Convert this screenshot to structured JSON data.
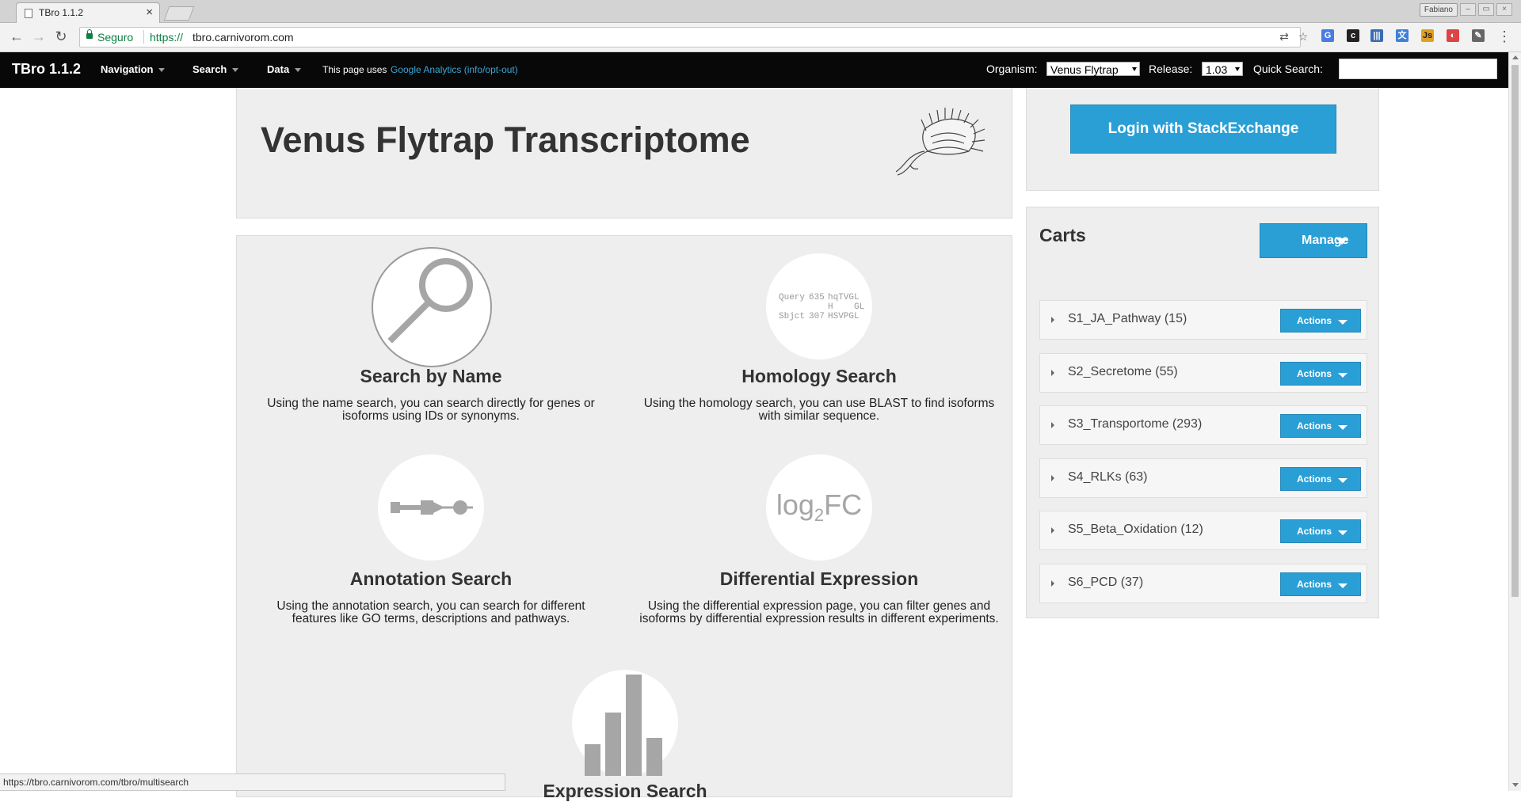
{
  "browser": {
    "tab_title": "TBro 1.1.2",
    "profile_name": "Fabiano",
    "secure_label": "Seguro",
    "url_scheme": "https://",
    "url_host": "tbro.carnivorom.com",
    "status_url": "https://tbro.carnivorom.com/tbro/multisearch"
  },
  "navbar": {
    "brand": "TBro 1.1.2",
    "menu": [
      "Navigation",
      "Search",
      "Data"
    ],
    "ga_text": "This page uses",
    "ga_link": "Google Analytics (info/opt-out)",
    "organism_label": "Organism:",
    "organism_value": "Venus Flytrap",
    "release_label": "Release:",
    "release_value": "1.03",
    "quick_search_label": "Quick Search:",
    "quick_search_value": ""
  },
  "hero": {
    "title": "Venus Flytrap Transcriptome"
  },
  "features": [
    {
      "title": "Search by Name",
      "description": "Using the name search, you can search directly for genes or isoforms using IDs or synonyms.",
      "icon": "magnifier-icon"
    },
    {
      "title": "Homology Search",
      "description": "Using the homology search, you can use BLAST to find isoforms with similar sequence.",
      "icon": "blast-alignment-icon"
    },
    {
      "title": "Annotation Search",
      "description": "Using the annotation search, you can search for different features like GO terms, descriptions and pathways.",
      "icon": "pathway-icon"
    },
    {
      "title": "Differential Expression",
      "description": "Using the differential expression page, you can filter genes and isoforms by differential expression results in different experiments.",
      "icon": "log2fc-icon"
    },
    {
      "title": "Expression Search",
      "description": "",
      "icon": "bar-chart-icon"
    }
  ],
  "blast_icon": {
    "query_label": "Query",
    "query_pos": "635",
    "query_seq": "hqTVGL",
    "mid_seq": "H    GL",
    "sbjct_label": "Sbjct",
    "sbjct_pos": "307",
    "sbjct_seq": "HSVPGL"
  },
  "log2fc_icon": {
    "log": "log",
    "sub": "2",
    "fc": "FC"
  },
  "sidebar": {
    "login_label": "Login with StackExchange",
    "carts_title": "Carts",
    "manage_label": "Manage",
    "actions_label": "Actions",
    "carts": [
      {
        "name": "S1_JA_Pathway (15)"
      },
      {
        "name": "S2_Secretome (55)"
      },
      {
        "name": "S3_Transportome (293)"
      },
      {
        "name": "S4_RLKs (63)"
      },
      {
        "name": "S5_Beta_Oxidation (12)"
      },
      {
        "name": "S6_PCD (37)"
      }
    ]
  },
  "colors": {
    "accent": "#2a9fd6",
    "navbar": "#080808",
    "panel": "#eeeeee",
    "link": "#38a6d8",
    "secure": "#0b8043"
  }
}
